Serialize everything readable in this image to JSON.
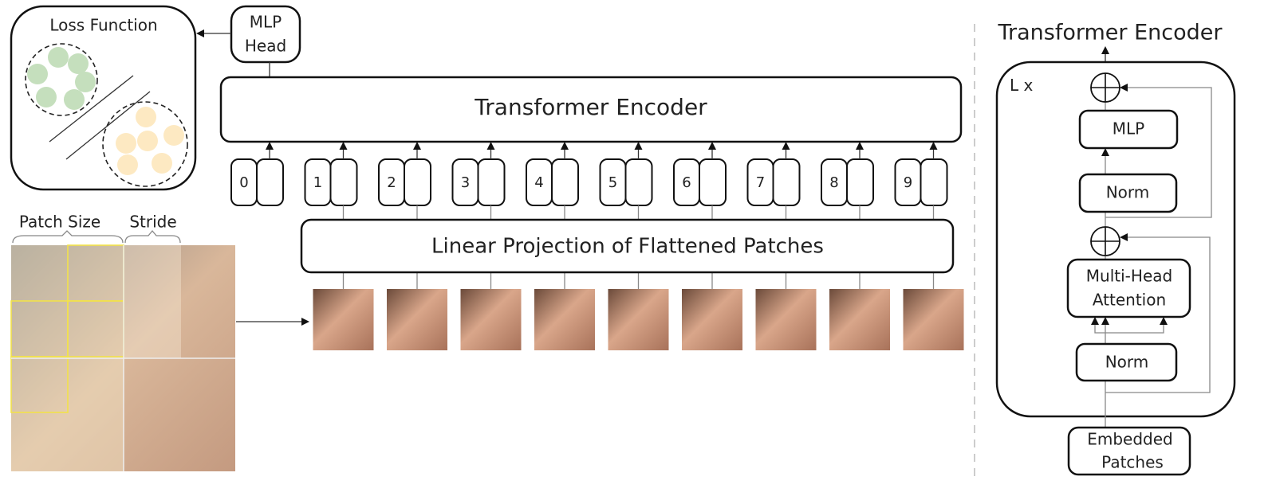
{
  "loss": {
    "title": "Loss Function",
    "colors": {
      "class_a": "#c5dfbd",
      "class_b": "#fde9c2"
    }
  },
  "mlp_head": {
    "line1": "MLP",
    "line2": "Head"
  },
  "encoder_block": {
    "label": "Transformer Encoder"
  },
  "tokens": [
    "0",
    "1",
    "2",
    "3",
    "4",
    "5",
    "6",
    "7",
    "8",
    "9"
  ],
  "projection": {
    "label": "Linear Projection of Flattened Patches"
  },
  "input_image": {
    "patch_size_label": "Patch Size",
    "stride_label": "Stride",
    "grid_color": "#f2e24a"
  },
  "detail": {
    "title": "Transformer Encoder",
    "repeat_label": "L x",
    "mlp": "MLP",
    "norm_top": "Norm",
    "mha_line1": "Multi-Head",
    "mha_line2": "Attention",
    "norm_bottom": "Norm",
    "input_line1": "Embedded",
    "input_line2": "Patches"
  }
}
